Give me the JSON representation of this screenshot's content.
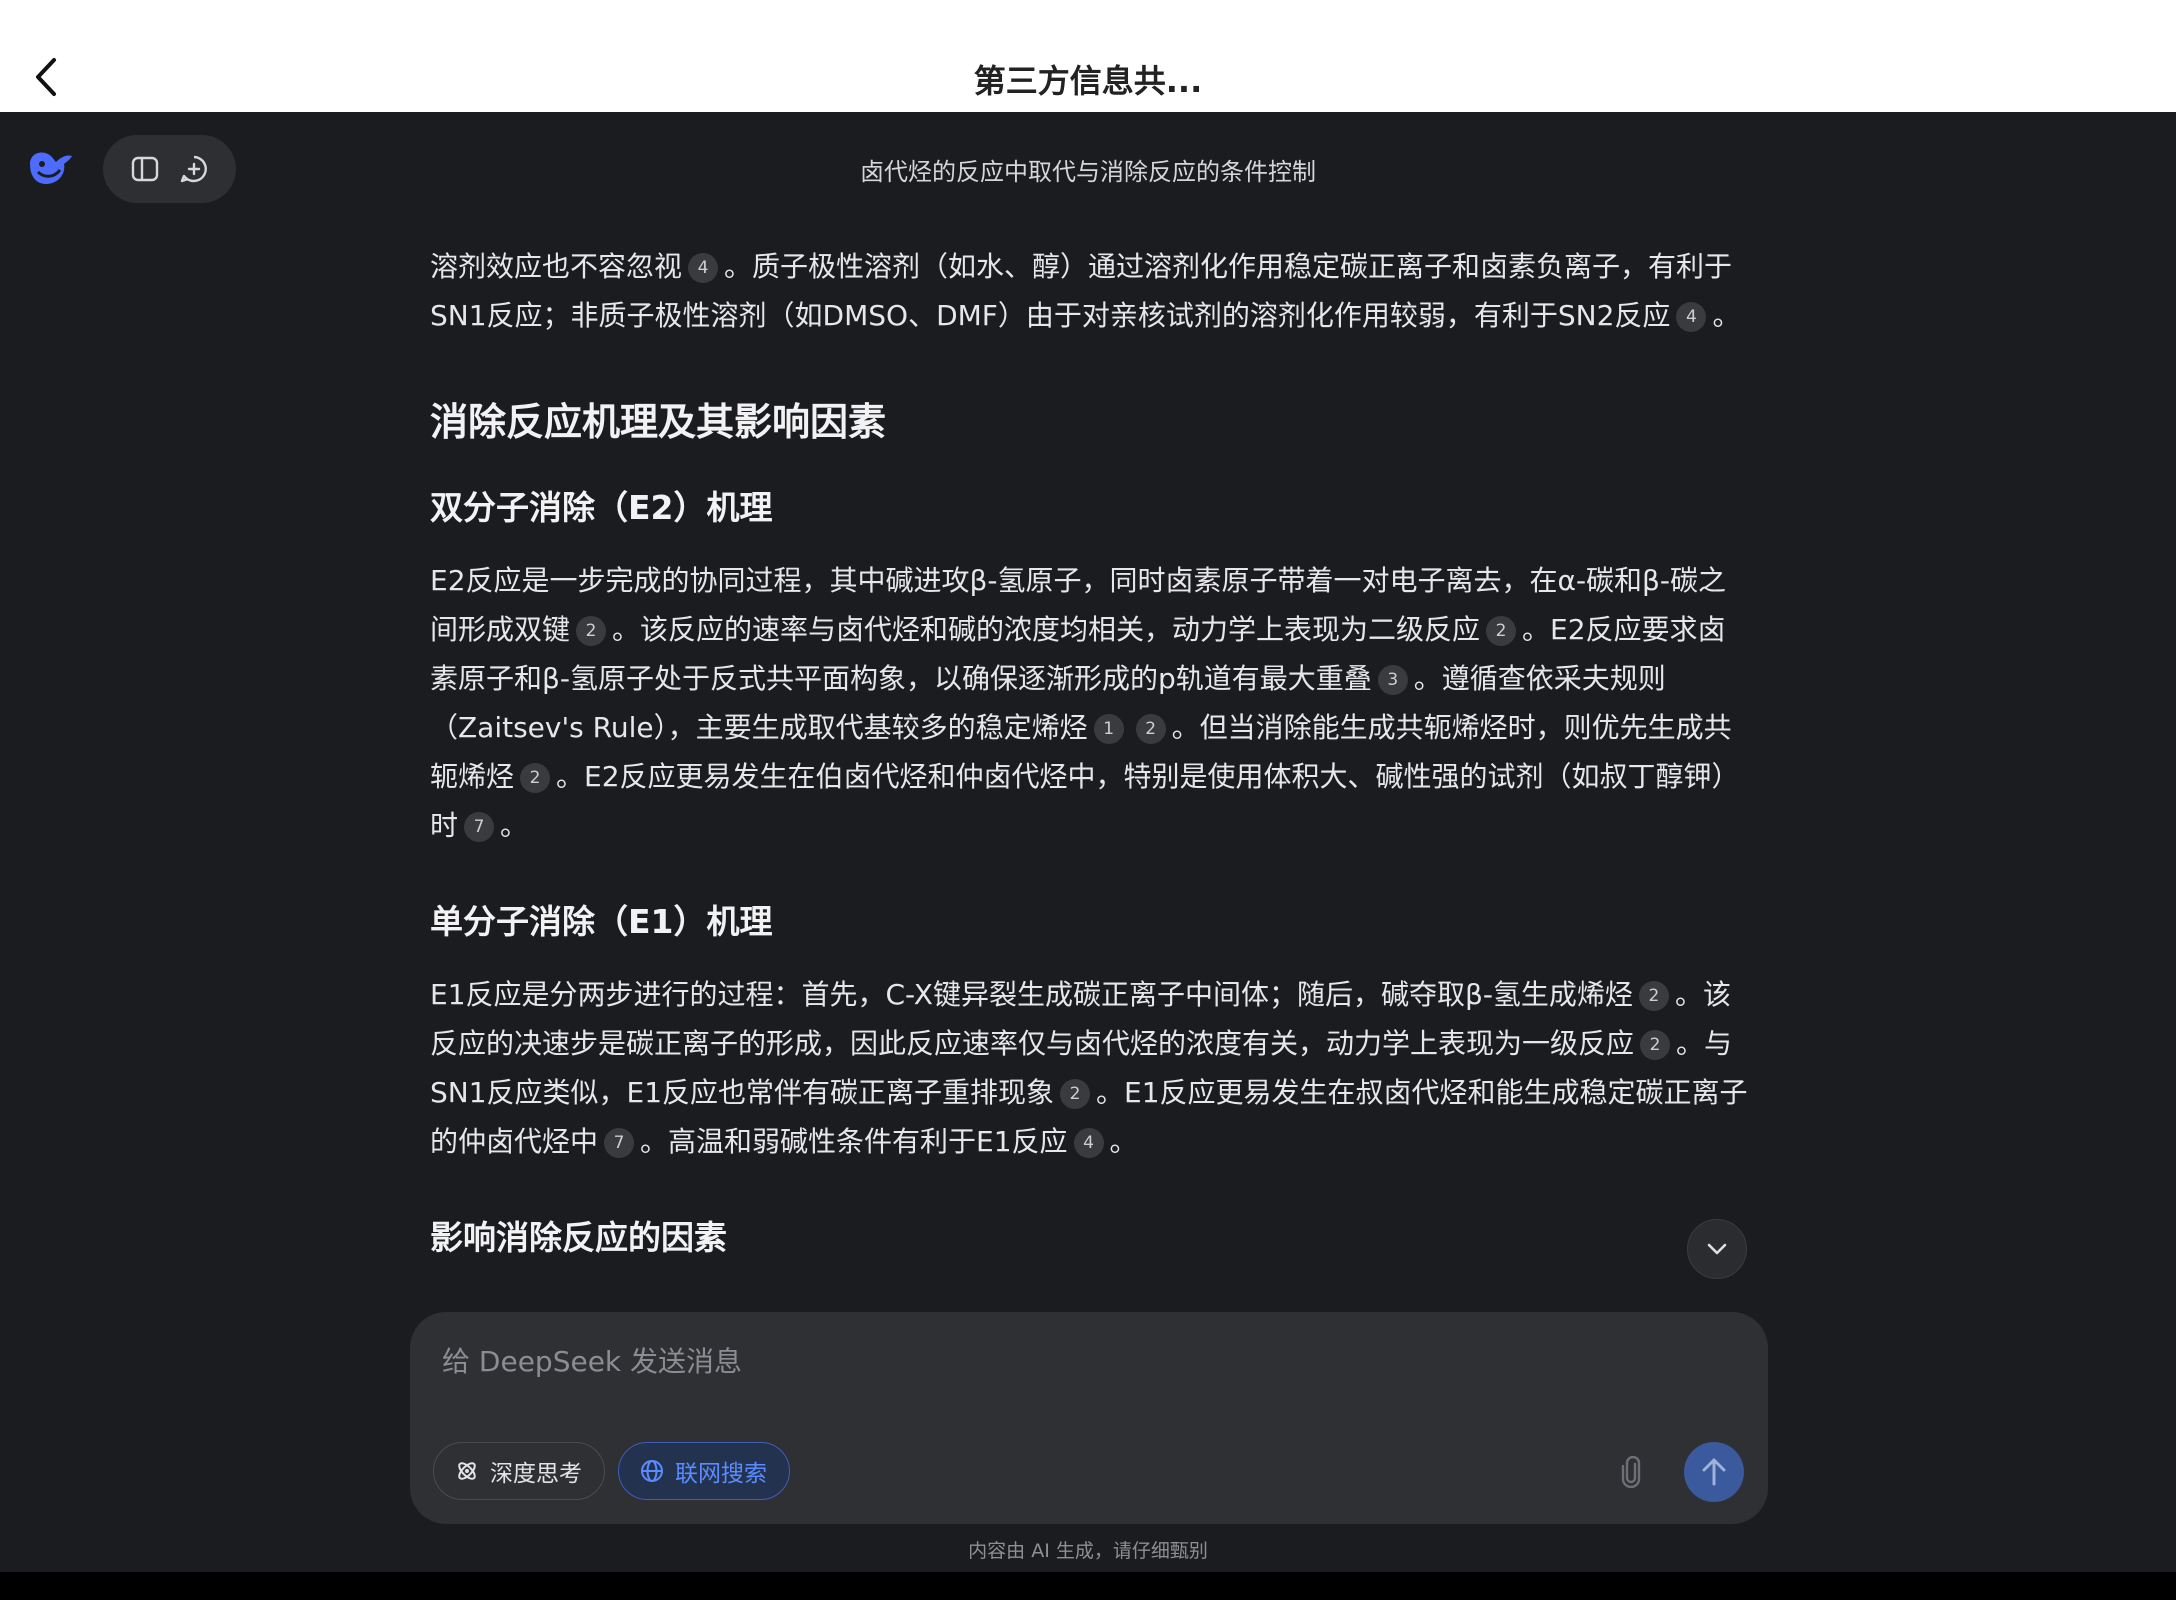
{
  "topbar": {
    "title": "第三方信息共..."
  },
  "header": {
    "chat_title": "卤代烃的反应中取代与消除反应的条件控制"
  },
  "content": {
    "p1": [
      {
        "t": "溶剂效应也不容忽视"
      },
      {
        "c": "4"
      },
      {
        "t": "。质子极性溶剂（如水、醇）通过溶剂化作用稳定碳正离子和卤素负离子，有利于SN1反应；非质子极性溶剂（如DMSO、DMF）由于对亲核试剂的溶剂化作用较弱，有利于SN2反应"
      },
      {
        "c": "4"
      },
      {
        "t": "。"
      }
    ],
    "h2_elim": "消除反应机理及其影响因素",
    "h3_e2": "双分子消除（E2）机理",
    "p_e2": [
      {
        "t": "E2反应是一步完成的协同过程，其中碱进攻β-氢原子，同时卤素原子带着一对电子离去，在α-碳和β-碳之间形成双键"
      },
      {
        "c": "2"
      },
      {
        "t": "。该反应的速率与卤代烃和碱的浓度均相关，动力学上表现为二级反应"
      },
      {
        "c": "2"
      },
      {
        "t": "。E2反应要求卤素原子和β-氢原子处于反式共平面构象，以确保逐渐形成的p轨道有最大重叠"
      },
      {
        "c": "3"
      },
      {
        "t": "。遵循查依采夫规则（Zaitsev's Rule），主要生成取代基较多的稳定烯烃"
      },
      {
        "c": "1"
      },
      {
        "c": "2"
      },
      {
        "t": "。但当消除能生成共轭烯烃时，则优先生成共轭烯烃"
      },
      {
        "c": "2"
      },
      {
        "t": "。E2反应更易发生在伯卤代烃和仲卤代烃中，特别是使用体积大、碱性强的试剂（如叔丁醇钾）时"
      },
      {
        "c": "7"
      },
      {
        "t": "。"
      }
    ],
    "h3_e1": "单分子消除（E1）机理",
    "p_e1": [
      {
        "t": "E1反应是分两步进行的过程：首先，C-X键异裂生成碳正离子中间体；随后，碱夺取β-氢生成烯烃"
      },
      {
        "c": "2"
      },
      {
        "t": "。该反应的决速步是碳正离子的形成，因此反应速率仅与卤代烃的浓度有关，动力学上表现为一级反应"
      },
      {
        "c": "2"
      },
      {
        "t": "。与SN1反应类似，E1反应也常伴有碳正离子重排现象"
      },
      {
        "c": "2"
      },
      {
        "t": "。E1反应更易发生在叔卤代烃和能生成稳定碳正离子的仲卤代烃中"
      },
      {
        "c": "7"
      },
      {
        "t": "。高温和弱碱性条件有利于E1反应"
      },
      {
        "c": "4"
      },
      {
        "t": "。"
      }
    ],
    "h3_factors": "影响消除反应的因素"
  },
  "composer": {
    "placeholder": "给 DeepSeek 发送消息",
    "deep_think_label": "深度思考",
    "web_search_label": "联网搜索"
  },
  "footer": {
    "disclaimer": "内容由 AI 生成，请仔细甄别"
  },
  "colors": {
    "accent": "#5b8cff",
    "send_bg": "#3a5a9d",
    "app_bg": "#1b1c1f",
    "logo": "#4d6bfe"
  },
  "icons": {
    "back": "chevron-left-icon",
    "logo": "deepseek-whale-icon",
    "sidebar": "sidebar-toggle-icon",
    "new_chat": "new-chat-icon",
    "scroll": "chevron-down-icon",
    "deep_think": "atom-icon",
    "web_search": "globe-icon",
    "attach": "paperclip-icon",
    "send": "arrow-up-icon"
  }
}
